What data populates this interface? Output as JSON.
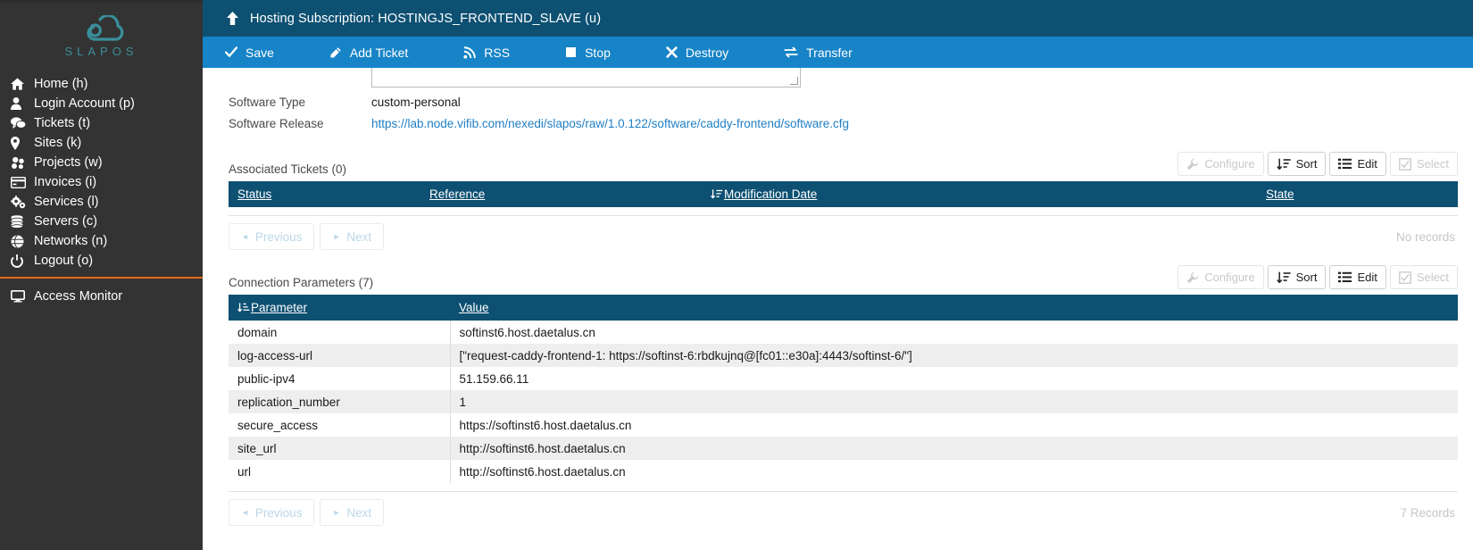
{
  "brand": {
    "logo_text": "SLAPOS",
    "logo_color": "#3a8f9b",
    "sidebar_bg": "#333333",
    "accent_color": "#e8681b"
  },
  "sidebar": {
    "items": [
      {
        "label": "Home (h)",
        "icon": "home-icon"
      },
      {
        "label": "Login Account (p)",
        "icon": "user-icon"
      },
      {
        "label": "Tickets (t)",
        "icon": "comments-icon"
      },
      {
        "label": "Sites (k)",
        "icon": "map-marker-icon"
      },
      {
        "label": "Projects (w)",
        "icon": "cubes-icon"
      },
      {
        "label": "Invoices (i)",
        "icon": "credit-card-icon"
      },
      {
        "label": "Services (l)",
        "icon": "cogs-icon"
      },
      {
        "label": "Servers (c)",
        "icon": "database-icon"
      },
      {
        "label": "Networks (n)",
        "icon": "globe-icon"
      },
      {
        "label": "Logout (o)",
        "icon": "power-icon"
      }
    ],
    "lower_items": [
      {
        "label": "Access Monitor",
        "icon": "monitor-icon"
      }
    ]
  },
  "header": {
    "icon": "arrow-up-icon",
    "title": "Hosting Subscription: HOSTINGJS_FRONTEND_SLAVE (u)",
    "bg": "#0d5072"
  },
  "actionbar": {
    "bg": "#1784c7",
    "actions": [
      {
        "label": "Save",
        "icon": "check-icon"
      },
      {
        "label": "Add Ticket",
        "icon": "ticket-icon"
      },
      {
        "label": "RSS",
        "icon": "rss-icon"
      },
      {
        "label": "Stop",
        "icon": "stop-square-icon"
      },
      {
        "label": "Destroy",
        "icon": "times-icon"
      },
      {
        "label": "Transfer",
        "icon": "exchange-icon"
      }
    ]
  },
  "form": {
    "fields": [
      {
        "label": "Software Type",
        "value": "custom-personal",
        "is_link": false
      },
      {
        "label": "Software Release",
        "value": "https://lab.node.vifib.com/nexedi/slapos/raw/1.0.122/software/caddy-frontend/software.cfg",
        "is_link": true
      }
    ]
  },
  "tickets_section": {
    "title": "Associated Tickets (0)",
    "tools": [
      {
        "label": "Configure",
        "icon": "wrench-icon",
        "disabled": true
      },
      {
        "label": "Sort",
        "icon": "sort-icon",
        "disabled": false
      },
      {
        "label": "Edit",
        "icon": "list-icon",
        "disabled": false
      },
      {
        "label": "Select",
        "icon": "checkbox-icon",
        "disabled": true
      }
    ],
    "columns": [
      {
        "label": "Status",
        "sorted": false
      },
      {
        "label": "Reference",
        "sorted": false
      },
      {
        "label": "Modification Date",
        "sorted": true
      },
      {
        "label": "State",
        "sorted": false
      }
    ],
    "rows": [],
    "pager": {
      "previous_label": "Previous",
      "next_label": "Next",
      "record_info": "No records"
    }
  },
  "connection_section": {
    "title": "Connection Parameters (7)",
    "tools": [
      {
        "label": "Configure",
        "icon": "wrench-icon",
        "disabled": true
      },
      {
        "label": "Sort",
        "icon": "sort-icon",
        "disabled": false
      },
      {
        "label": "Edit",
        "icon": "list-icon",
        "disabled": false
      },
      {
        "label": "Select",
        "icon": "checkbox-icon",
        "disabled": true
      }
    ],
    "columns": [
      {
        "label": "Parameter",
        "sorted": true
      },
      {
        "label": "Value",
        "sorted": false
      }
    ],
    "rows": [
      {
        "parameter": "domain",
        "value": "softinst6.host.daetalus.cn"
      },
      {
        "parameter": "log-access-url",
        "value": "[\"request-caddy-frontend-1: https://softinst-6:rbdkujnq@[fc01::e30a]:4443/softinst-6/\"]"
      },
      {
        "parameter": "public-ipv4",
        "value": "51.159.66.11"
      },
      {
        "parameter": "replication_number",
        "value": "1"
      },
      {
        "parameter": "secure_access",
        "value": "https://softinst6.host.daetalus.cn"
      },
      {
        "parameter": "site_url",
        "value": "http://softinst6.host.daetalus.cn"
      },
      {
        "parameter": "url",
        "value": "http://softinst6.host.daetalus.cn"
      }
    ],
    "pager": {
      "previous_label": "Previous",
      "next_label": "Next",
      "record_info": "7 Records"
    }
  }
}
